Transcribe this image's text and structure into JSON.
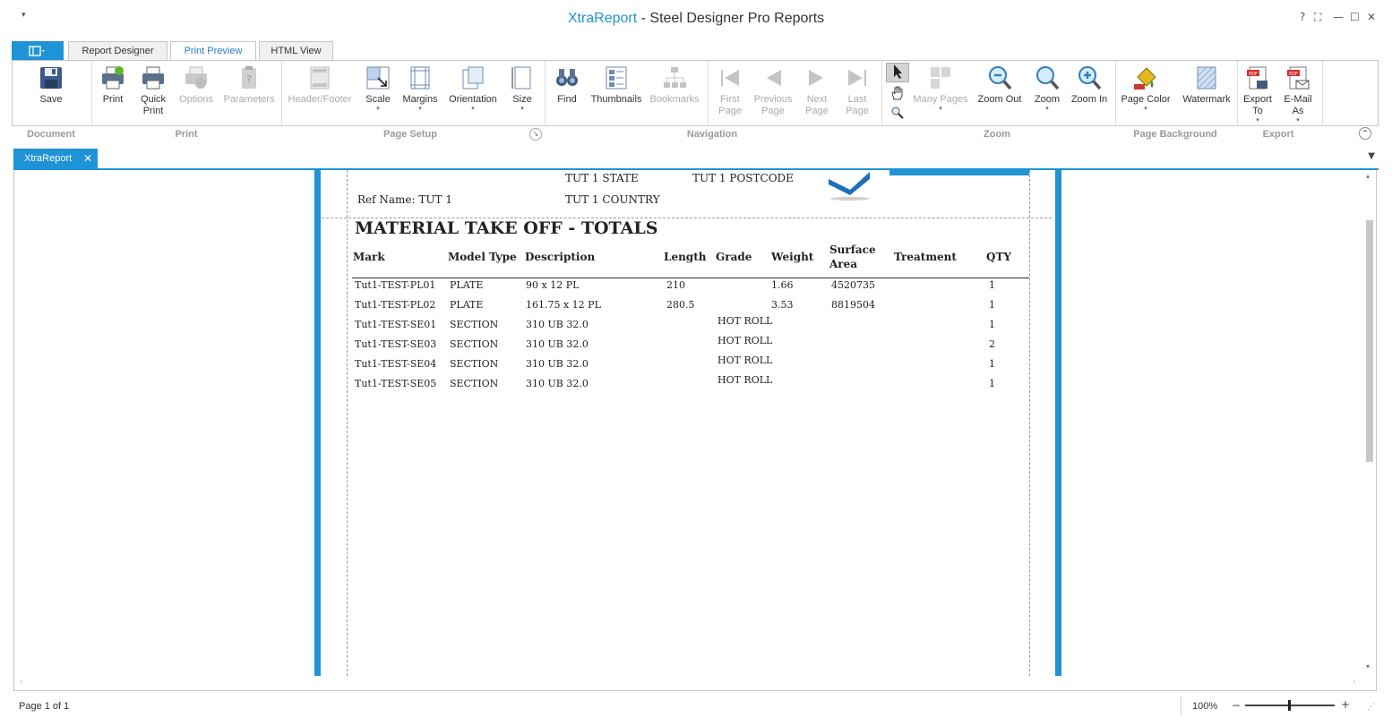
{
  "window": {
    "title_accent": "XtraReport",
    "title_rest": " - Steel Designer Pro Reports",
    "controls": [
      "?",
      "⛶",
      "—",
      "☐",
      "✕"
    ]
  },
  "tabs": [
    {
      "label": "Report Designer"
    },
    {
      "label": "Print Preview"
    },
    {
      "label": "HTML View"
    }
  ],
  "ribbon": {
    "save": "Save",
    "print": "Print",
    "quick_print": "Quick Print",
    "options": "Options",
    "parameters": "Parameters",
    "header_footer": "Header/Footer",
    "scale": "Scale",
    "margins": "Margins",
    "orientation": "Orientation",
    "size": "Size",
    "find": "Find",
    "thumbnails": "Thumbnails",
    "bookmarks": "Bookmarks",
    "first_page": "First Page",
    "previous_page": "Previous Page",
    "next_page": "Next Page",
    "last_page": "Last Page",
    "many_pages": "Many Pages",
    "zoom_out": "Zoom Out",
    "zoom": "Zoom",
    "zoom_in": "Zoom In",
    "page_color": "Page Color",
    "watermark": "Watermark",
    "export_to": "Export To",
    "email_as": "E-Mail As"
  },
  "groups": {
    "document": "Document",
    "print": "Print",
    "page_setup": "Page Setup",
    "navigation": "Navigation",
    "zoom": "Zoom",
    "page_background": "Page Background",
    "export": "Export"
  },
  "doc_tab": {
    "label": "XtraReport"
  },
  "report": {
    "state": "TUT 1 STATE",
    "postcode": "TUT 1 POSTCODE",
    "ref_name": "Ref Name: TUT 1",
    "country": "TUT 1 COUNTRY",
    "title": "MATERIAL TAKE OFF - TOTALS",
    "headers": {
      "mark": "Mark",
      "model_type": "Model Type",
      "description": "Description",
      "length": "Length",
      "grade": "Grade",
      "weight": "Weight",
      "surface": "Surface",
      "area": "Area",
      "treatment": "Treatment",
      "qty": "QTY"
    },
    "rows": [
      {
        "mark": "Tut1-TEST-PL01",
        "model_type": "PLATE",
        "description": "90 x 12 PL",
        "length": "210",
        "grade": "",
        "weight": "1.66",
        "area": "4520735",
        "treatment": "",
        "qty": "1"
      },
      {
        "mark": "Tut1-TEST-PL02",
        "model_type": "PLATE",
        "description": "161.75 x 12 PL",
        "length": "280.5",
        "grade": "",
        "weight": "3.53",
        "area": "8819504",
        "treatment": "",
        "qty": "1"
      },
      {
        "mark": "Tut1-TEST-SE01",
        "model_type": "SECTION",
        "description": "310 UB 32.0",
        "length": "",
        "grade": "HOT ROLL",
        "weight": "",
        "area": "",
        "treatment": "",
        "qty": "1"
      },
      {
        "mark": "Tut1-TEST-SE03",
        "model_type": "SECTION",
        "description": "310 UB 32.0",
        "length": "",
        "grade": "HOT ROLL",
        "weight": "",
        "area": "",
        "treatment": "",
        "qty": "2"
      },
      {
        "mark": "Tut1-TEST-SE04",
        "model_type": "SECTION",
        "description": "310 UB 32.0",
        "length": "",
        "grade": "HOT ROLL",
        "weight": "",
        "area": "",
        "treatment": "",
        "qty": "1"
      },
      {
        "mark": "Tut1-TEST-SE05",
        "model_type": "SECTION",
        "description": "310 UB 32.0",
        "length": "",
        "grade": "HOT ROLL",
        "weight": "",
        "area": "",
        "treatment": "",
        "qty": "1"
      }
    ]
  },
  "status": {
    "page": "Page 1 of 1",
    "zoom": "100%",
    "zoom_minus": "−",
    "zoom_plus": "+"
  },
  "colors": {
    "accent": "#1e93d6"
  }
}
